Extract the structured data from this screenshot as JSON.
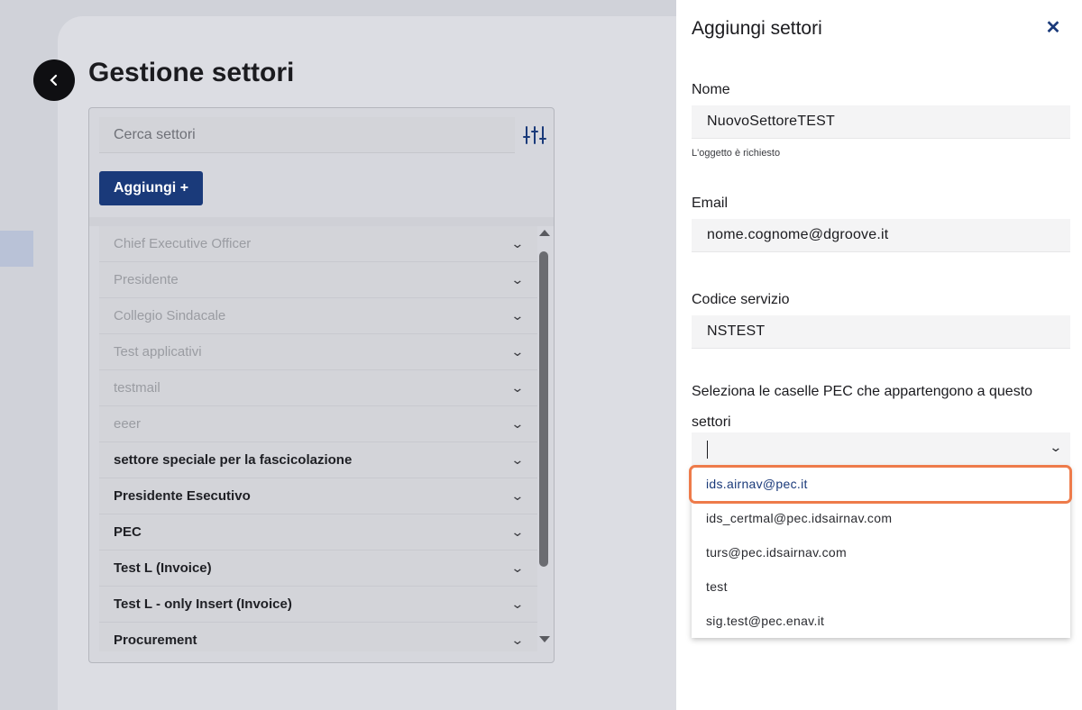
{
  "background": {
    "page_title": "Gestione settori",
    "back_icon": "chevron-left-icon",
    "search_placeholder": "Cerca settori",
    "filter_icon": "sliders-icon",
    "add_button": "Aggiungi +",
    "list_items": [
      {
        "label": "Chief Executive Officer",
        "dim": true
      },
      {
        "label": "Presidente",
        "dim": true
      },
      {
        "label": "Collegio Sindacale",
        "dim": true
      },
      {
        "label": "Test applicativi",
        "dim": true
      },
      {
        "label": "testmail",
        "dim": true
      },
      {
        "label": "eeer",
        "dim": true
      },
      {
        "label": "settore speciale per la fascicolazione",
        "dim": false
      },
      {
        "label": "Presidente Esecutivo",
        "dim": false
      },
      {
        "label": "PEC",
        "dim": false
      },
      {
        "label": "Test L (Invoice)",
        "dim": false
      },
      {
        "label": "Test L - only Insert (Invoice)",
        "dim": false
      },
      {
        "label": "Procurement",
        "dim": false
      }
    ]
  },
  "drawer": {
    "title": "Aggiungi settori",
    "close_icon": "close-icon",
    "nome_label": "Nome",
    "nome_value": "NuovoSettoreTEST",
    "nome_helper": "L'oggetto è richiesto",
    "email_label": "Email",
    "email_value": "nome.cognome@dgroove.it",
    "codice_label": "Codice servizio",
    "codice_value": "NSTEST",
    "pec_label": "Seleziona le caselle PEC che appartengono a questo settori",
    "pec_options": [
      "ids.airnav@pec.it",
      "ids_certmal@pec.idsairnav.com",
      "turs@pec.idsairnav.com",
      "test",
      "sig.test@pec.enav.it"
    ],
    "highlighted_option_index": 0
  },
  "colors": {
    "accent": "#1a3a7a",
    "highlight": "#ee7b4a"
  }
}
